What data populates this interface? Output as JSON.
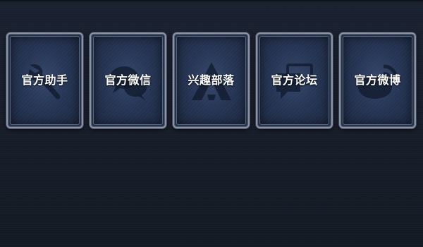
{
  "tiles": [
    {
      "label": "官方助手",
      "icon": "assistant-icon"
    },
    {
      "label": "官方微信",
      "icon": "wechat-icon"
    },
    {
      "label": "兴趣部落",
      "icon": "tribe-icon"
    },
    {
      "label": "官方论坛",
      "icon": "forum-icon"
    },
    {
      "label": "官方微博",
      "icon": "weibo-icon"
    }
  ],
  "colors": {
    "background": "#151b26",
    "tile_fill": "#273656",
    "tile_border": "#8a94a6",
    "label": "#ffffff"
  }
}
